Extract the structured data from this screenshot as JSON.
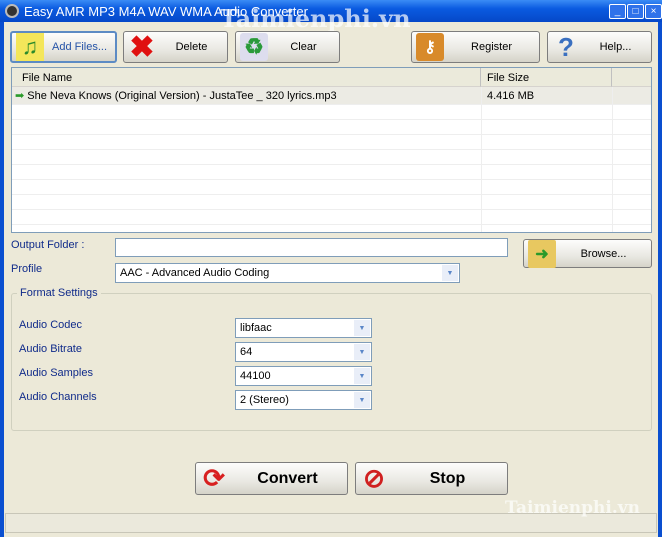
{
  "window": {
    "title": "Easy AMR MP3 M4A WAV WMA Audio Converter",
    "minimize": "_",
    "maximize": "□",
    "close": "×"
  },
  "toolbar": {
    "add_files": "Add Files...",
    "delete": "Delete",
    "clear": "Clear",
    "register": "Register",
    "help": "Help..."
  },
  "file_list": {
    "columns": [
      "File Name",
      "File Size"
    ],
    "rows": [
      {
        "name": "She Neva Knows (Original Version) - JustaTee _ 320 lyrics.mp3",
        "size": "4.416 MB"
      }
    ]
  },
  "output": {
    "label": "Output Folder :",
    "value": "",
    "browse": "Browse..."
  },
  "profile": {
    "label": "Profile",
    "value": "AAC - Advanced Audio Coding"
  },
  "format_settings": {
    "title": "Format Settings",
    "fields": [
      {
        "label": "Audio Codec",
        "value": "libfaac"
      },
      {
        "label": "Audio Bitrate",
        "value": "64"
      },
      {
        "label": "Audio Samples",
        "value": "44100"
      },
      {
        "label": "Audio Channels",
        "value": "2 (Stereo)"
      }
    ]
  },
  "actions": {
    "convert": "Convert",
    "stop": "Stop"
  },
  "watermark": "Taimienphi.vn"
}
